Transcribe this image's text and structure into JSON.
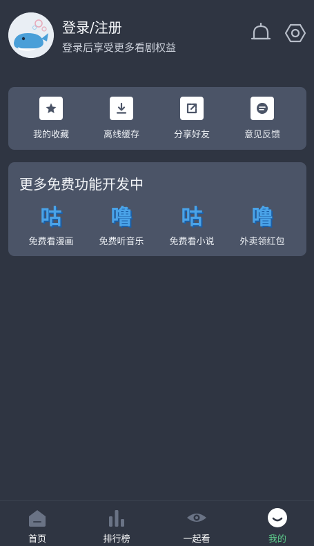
{
  "header": {
    "title": "登录/注册",
    "subtitle": "登录后享受更多看剧权益",
    "icons": [
      "bell-icon",
      "settings-icon"
    ]
  },
  "quick_actions": [
    {
      "label": "我的收藏",
      "icon": "star-icon"
    },
    {
      "label": "离线缓存",
      "icon": "download-icon"
    },
    {
      "label": "分享好友",
      "icon": "share-icon"
    },
    {
      "label": "意见反馈",
      "icon": "feedback-icon"
    }
  ],
  "more_features": {
    "title": "更多免费功能开发中",
    "items": [
      {
        "glyph": "咕",
        "label": "免费看漫画"
      },
      {
        "glyph": "噜",
        "label": "免费听音乐"
      },
      {
        "glyph": "咕",
        "label": "免费看小说"
      },
      {
        "glyph": "噜",
        "label": "外卖领红包"
      }
    ]
  },
  "tabbar": [
    {
      "label": "首页",
      "icon": "home-icon"
    },
    {
      "label": "排行榜",
      "icon": "ranking-icon"
    },
    {
      "label": "一起看",
      "icon": "eye-icon"
    },
    {
      "label": "我的",
      "icon": "profile-icon",
      "active": true
    }
  ],
  "colors": {
    "background": "#2f3542",
    "card": "#4b5467",
    "accent_active": "#5cc98a",
    "glyph_blue": "#4aa3e8"
  }
}
